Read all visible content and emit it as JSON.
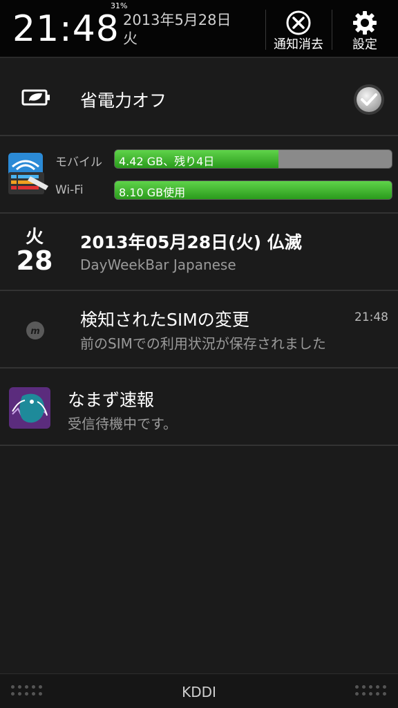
{
  "header": {
    "time": "21:48",
    "battery": "31%",
    "date_line1": "2013年5月28日",
    "date_line2": "火",
    "clear_label": "通知消去",
    "settings_label": "設定"
  },
  "power_saver": {
    "label": "省電力オフ",
    "checked": true
  },
  "data_usage": {
    "mobile_label": "モバイル",
    "mobile_text": "4.42 GB、残り4日",
    "mobile_fraction": 0.59,
    "wifi_label": "Wi-Fi",
    "wifi_text": "8.10 GB使用",
    "wifi_fraction": 1.0
  },
  "calendar": {
    "weekday": "火",
    "day": "28",
    "title": "2013年05月28日(火) 仏滅",
    "subtitle": "DayWeekBar Japanese"
  },
  "sim": {
    "title": "検知されたSIMの変更",
    "subtitle": "前のSIMでの利用状況が保存されました",
    "time": "21:48"
  },
  "earthquake": {
    "title": "なまず速報",
    "subtitle": "受信待機中です。"
  },
  "footer": {
    "carrier": "KDDI"
  }
}
